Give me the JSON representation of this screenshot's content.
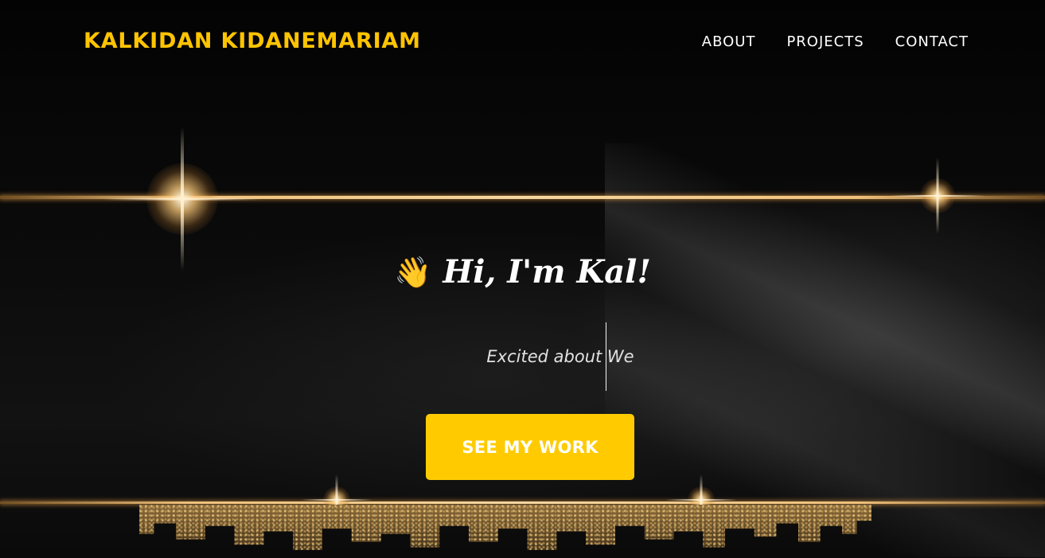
{
  "header": {
    "brand": "KALKIDAN KIDANEMARIAM",
    "nav": [
      {
        "label": "ABOUT"
      },
      {
        "label": "PROJECTS"
      },
      {
        "label": "CONTACT"
      }
    ]
  },
  "hero": {
    "wave_icon": "waving-hand",
    "wave_glyph": "👋",
    "greeting": "Hi, I'm Kal!",
    "typing_text": "Excited about We",
    "cta_label": "SEE MY WORK"
  },
  "colors": {
    "accent": "#ffcb00",
    "brand_text": "#ffc400",
    "background": "#050505",
    "gold_line": "#f0c07a"
  }
}
